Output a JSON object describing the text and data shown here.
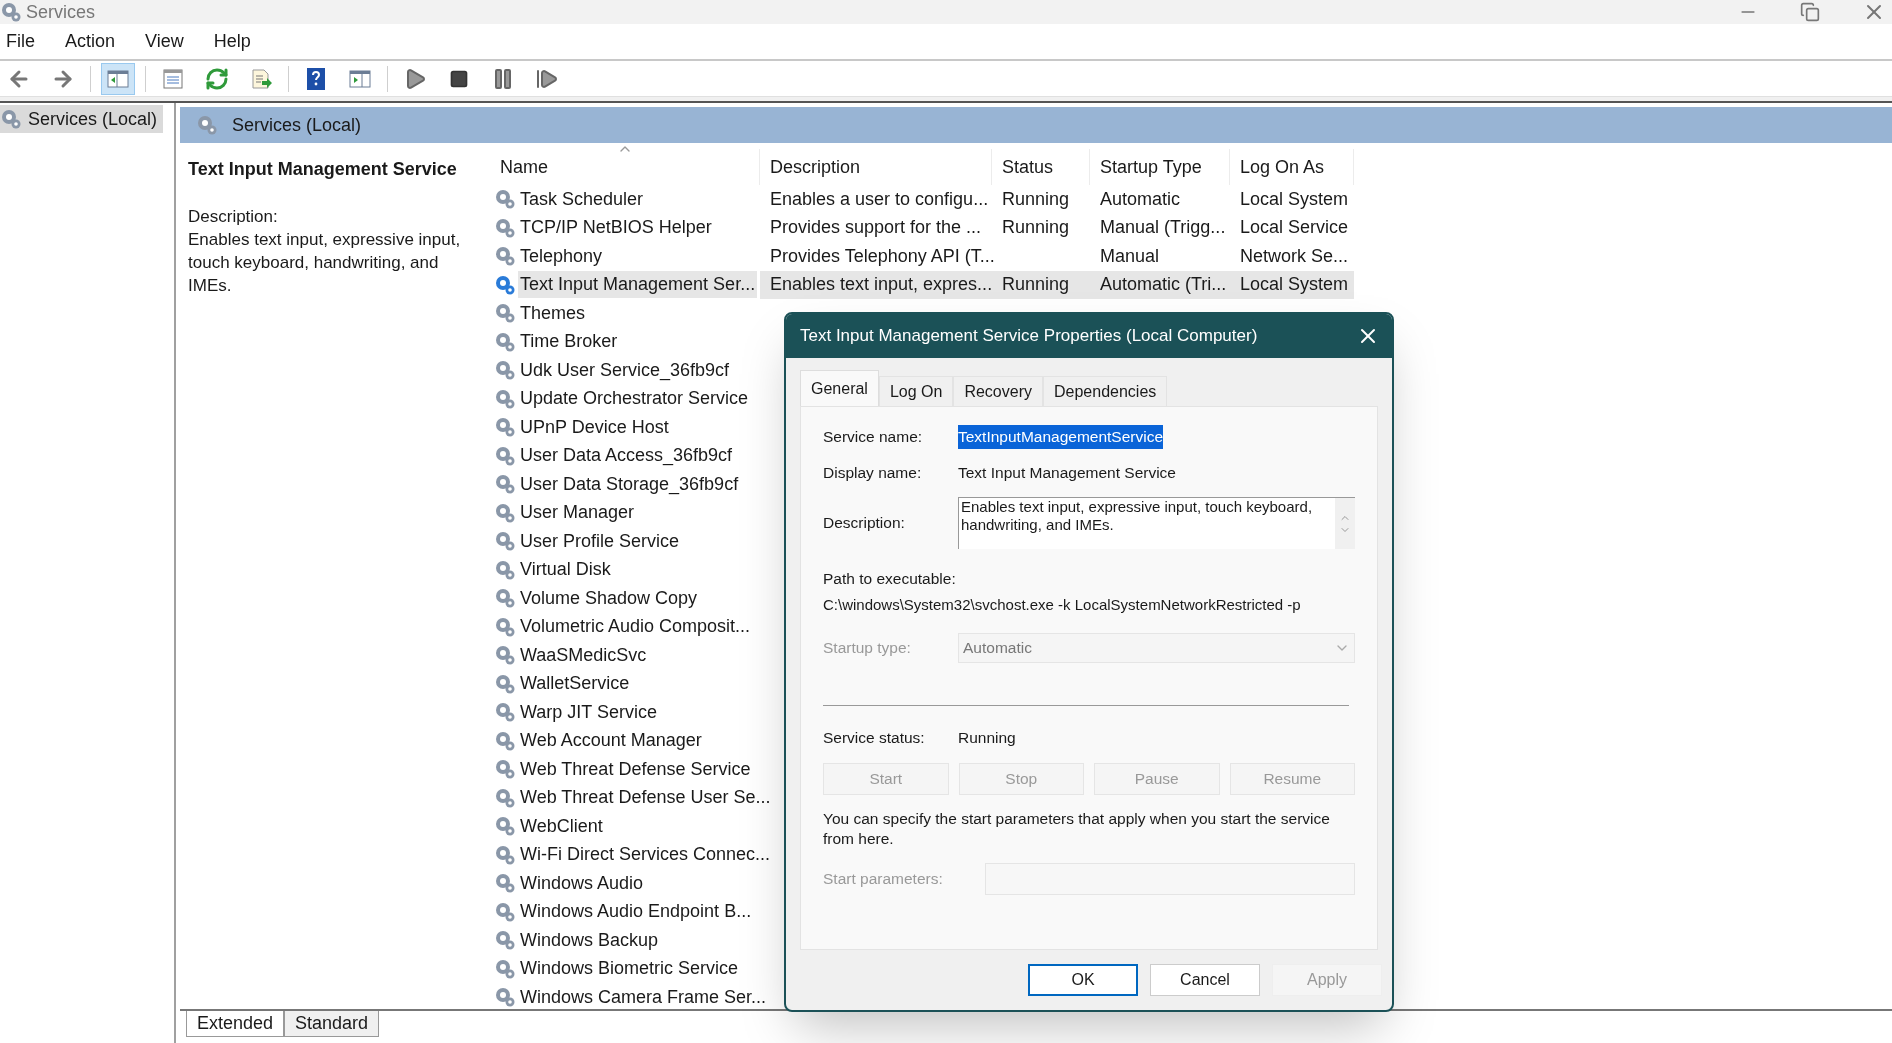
{
  "window": {
    "title": "Services"
  },
  "menu": [
    "File",
    "Action",
    "View",
    "Help"
  ],
  "toolbar": [
    {
      "kind": "back",
      "selected": false
    },
    {
      "kind": "forward",
      "selected": false
    },
    {
      "kind": "tree",
      "selected": true
    },
    {
      "kind": "properties",
      "selected": false
    },
    {
      "kind": "refresh",
      "selected": false
    },
    {
      "kind": "export",
      "selected": false
    },
    {
      "kind": "help",
      "selected": false
    },
    {
      "kind": "console",
      "selected": false
    },
    {
      "kind": "play",
      "selected": false
    },
    {
      "kind": "stop",
      "selected": false
    },
    {
      "kind": "pause",
      "selected": false
    },
    {
      "kind": "resume",
      "selected": false
    }
  ],
  "tree": {
    "items": [
      {
        "label": "Services (Local)",
        "selected": true
      }
    ]
  },
  "pane_header": "Services (Local)",
  "detail": {
    "title": "Text Input Management Service",
    "description_label": "Description:",
    "description": "Enables text input, expressive input, touch keyboard, handwriting, and IMEs."
  },
  "table": {
    "columns": [
      {
        "label": "Name",
        "sorted": true
      },
      {
        "label": "Description",
        "sorted": false
      },
      {
        "label": "Status",
        "sorted": false
      },
      {
        "label": "Startup Type",
        "sorted": false
      },
      {
        "label": "Log On As",
        "sorted": false
      }
    ],
    "rows": [
      {
        "name": "Task Scheduler",
        "description": "Enables a user to configu...",
        "status": "Running",
        "startup_type": "Automatic",
        "log_on_as": "Local System",
        "selected": false
      },
      {
        "name": "TCP/IP NetBIOS Helper",
        "description": "Provides support for the ...",
        "status": "Running",
        "startup_type": "Manual (Trigg...",
        "log_on_as": "Local Service",
        "selected": false
      },
      {
        "name": "Telephony",
        "description": "Provides Telephony API (T...",
        "startup_type": "Manual",
        "log_on_as": "Network Se...",
        "selected": false
      },
      {
        "name": "Text Input Management Ser...",
        "description": "Enables text input, expres...",
        "status": "Running",
        "startup_type": "Automatic (Tri...",
        "log_on_as": "Local System",
        "selected": true
      },
      {
        "name": "Themes",
        "selected": false
      },
      {
        "name": "Time Broker",
        "selected": false
      },
      {
        "name": "Udk User Service_36fb9cf",
        "selected": false
      },
      {
        "name": "Update Orchestrator Service",
        "selected": false
      },
      {
        "name": "UPnP Device Host",
        "selected": false
      },
      {
        "name": "User Data Access_36fb9cf",
        "selected": false
      },
      {
        "name": "User Data Storage_36fb9cf",
        "selected": false
      },
      {
        "name": "User Manager",
        "selected": false
      },
      {
        "name": "User Profile Service",
        "selected": false
      },
      {
        "name": "Virtual Disk",
        "selected": false
      },
      {
        "name": "Volume Shadow Copy",
        "selected": false
      },
      {
        "name": "Volumetric Audio Composit...",
        "selected": false
      },
      {
        "name": "WaaSMedicSvc",
        "selected": false
      },
      {
        "name": "WalletService",
        "selected": false
      },
      {
        "name": "Warp JIT Service",
        "selected": false
      },
      {
        "name": "Web Account Manager",
        "selected": false
      },
      {
        "name": "Web Threat Defense Service",
        "selected": false
      },
      {
        "name": "Web Threat Defense User Se...",
        "selected": false
      },
      {
        "name": "WebClient",
        "selected": false
      },
      {
        "name": "Wi-Fi Direct Services Connec...",
        "selected": false
      },
      {
        "name": "Windows Audio",
        "selected": false
      },
      {
        "name": "Windows Audio Endpoint B...",
        "selected": false
      },
      {
        "name": "Windows Backup",
        "selected": false
      },
      {
        "name": "Windows Biometric Service",
        "selected": false
      },
      {
        "name": "Windows Camera Frame Ser...",
        "selected": false
      }
    ]
  },
  "bottom_tabs": [
    {
      "label": "Extended",
      "selected": true
    },
    {
      "label": "Standard",
      "selected": false
    }
  ],
  "dialog": {
    "title": "Text Input Management Service Properties (Local Computer)",
    "tabs": [
      {
        "label": "General",
        "selected": true
      },
      {
        "label": "Log On",
        "selected": false
      },
      {
        "label": "Recovery",
        "selected": false
      },
      {
        "label": "Dependencies",
        "selected": false
      }
    ],
    "service_name": {
      "label": "Service name:",
      "value": "TextInputManagementService",
      "selected": true
    },
    "display_name": {
      "label": "Display name:",
      "value": "Text Input Management Service"
    },
    "description": {
      "label": "Description:",
      "value": "Enables text input, expressive input, touch keyboard, handwriting, and IMEs."
    },
    "path": {
      "label": "Path to executable:",
      "value": "C:\\windows\\System32\\svchost.exe -k LocalSystemNetworkRestricted -p"
    },
    "startup_type": {
      "label": "Startup type:",
      "value": "Automatic",
      "disabled": true
    },
    "service_status": {
      "label": "Service status:",
      "value": "Running"
    },
    "control_buttons": [
      {
        "label": "Start",
        "disabled": true
      },
      {
        "label": "Stop",
        "disabled": true
      },
      {
        "label": "Pause",
        "disabled": true
      },
      {
        "label": "Resume",
        "disabled": true
      }
    ],
    "hint": "You can specify the start parameters that apply when you start the service from here.",
    "start_parameters": {
      "label": "Start parameters:",
      "disabled": true
    },
    "buttons": [
      {
        "label": "OK",
        "disabled": false,
        "default": true
      },
      {
        "label": "Cancel",
        "disabled": false,
        "default": false
      },
      {
        "label": "Apply",
        "disabled": true,
        "default": false
      }
    ]
  }
}
